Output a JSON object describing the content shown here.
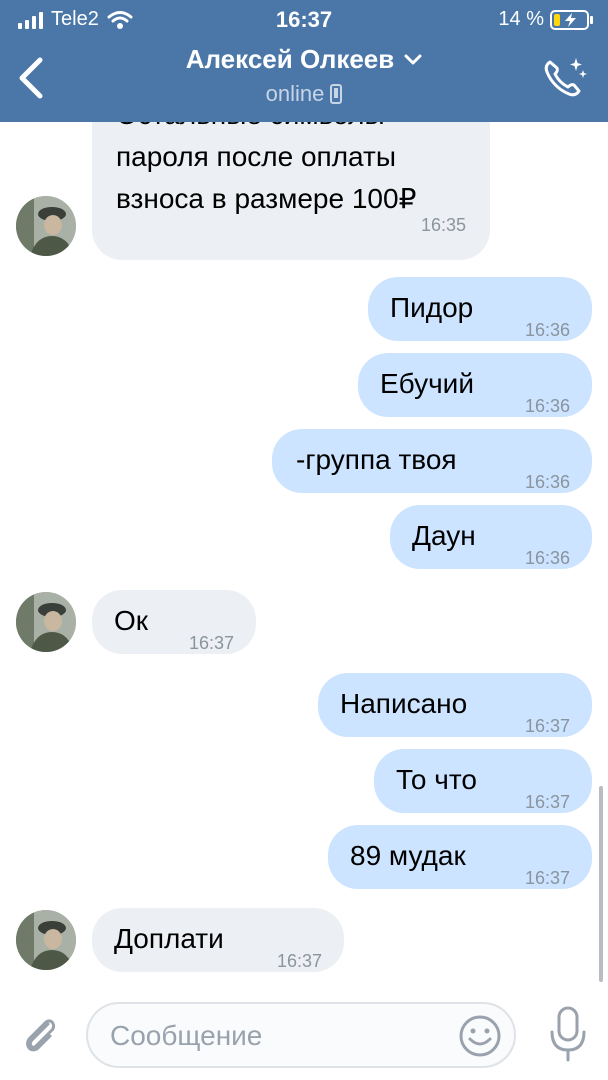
{
  "status_bar": {
    "carrier": "Tele2",
    "time": "16:37",
    "battery": "14 %"
  },
  "header": {
    "contact_name": "Алексей Олкеев",
    "status": "online"
  },
  "messages": [
    {
      "direction": "in",
      "text_lines": [
        "Остальные символы",
        "пароля после оплаты",
        "взноса в размере 100₽"
      ],
      "time": "16:35"
    },
    {
      "direction": "out",
      "text": "Пидор",
      "time": "16:36"
    },
    {
      "direction": "out",
      "text": "Ебучий",
      "time": "16:36"
    },
    {
      "direction": "out",
      "text": "-группа твоя",
      "time": "16:36"
    },
    {
      "direction": "out",
      "text": "Даун",
      "time": "16:36"
    },
    {
      "direction": "in",
      "text": "Ок",
      "time": "16:37"
    },
    {
      "direction": "out",
      "text": "Написано",
      "time": "16:37"
    },
    {
      "direction": "out",
      "text": "То что",
      "time": "16:37"
    },
    {
      "direction": "out",
      "text": "89 мудак",
      "time": "16:37"
    },
    {
      "direction": "in",
      "text": "Доплати",
      "time": "16:37"
    }
  ],
  "composer": {
    "placeholder": "Сообщение"
  },
  "icons": [
    "back-arrow-icon",
    "chevron-down-icon",
    "phone-icon",
    "call-icon",
    "attach-icon",
    "smile-icon",
    "mic-icon",
    "signal-icon",
    "wifi-icon",
    "battery-icon"
  ],
  "colors": {
    "header": "#4a76a8",
    "incoming_bubble": "#eceff3",
    "outgoing_bubble": "#cce4ff",
    "time_text": "#8a949e"
  }
}
